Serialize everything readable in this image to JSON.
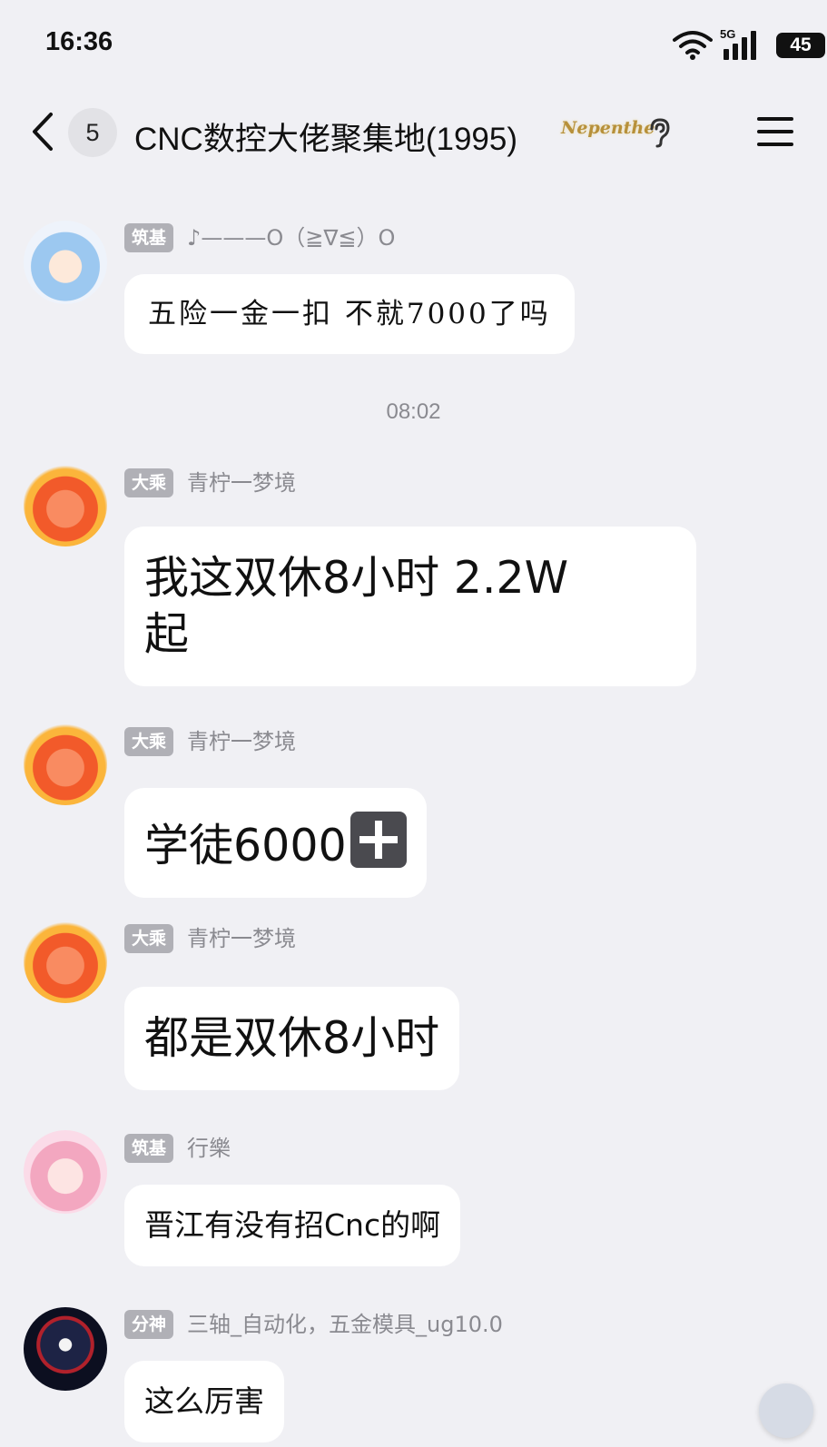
{
  "status_bar": {
    "time": "16:36",
    "network": "5G",
    "battery": "45",
    "icons": [
      "wifi-icon",
      "signal-icon",
      "battery-icon"
    ]
  },
  "header": {
    "unread_count": "5",
    "title": "CNC数控大佬聚集地(1995)",
    "badge": "Nepenthe",
    "icons": [
      "back-icon",
      "ear-icon",
      "menu-icon"
    ]
  },
  "timestamp_divider": "08:02",
  "messages": [
    {
      "level": "筑基",
      "sender": "♪———O（≧∇≦）O",
      "text": "五险一金一扣 不就7000了吗",
      "avatar": "avatar-rem"
    },
    {
      "level": "大乘",
      "sender": "青柠一梦境",
      "text_line1": "我这双休8小时 2.2W",
      "text_line2": "起",
      "avatar": "avatar-fire"
    },
    {
      "level": "大乘",
      "sender": "青柠一梦境",
      "text": "学徒6000",
      "emoji": "plus-icon",
      "avatar": "avatar-fire"
    },
    {
      "level": "大乘",
      "sender": "青柠一梦境",
      "text": "都是双休8小时",
      "avatar": "avatar-fire"
    },
    {
      "level": "筑基",
      "sender": "行樂",
      "text": "晋江有没有招Cnc的啊",
      "avatar": "avatar-pink"
    },
    {
      "level": "分神",
      "sender": "三轴_自动化，五金模具_ug10.0",
      "text": "这么厉害",
      "avatar": "avatar-dark"
    }
  ],
  "colors": {
    "background": "#f0f0f4",
    "bubble": "#ffffff",
    "level_tag": "#b0b0b6",
    "meta_text": "#8a8a90"
  }
}
